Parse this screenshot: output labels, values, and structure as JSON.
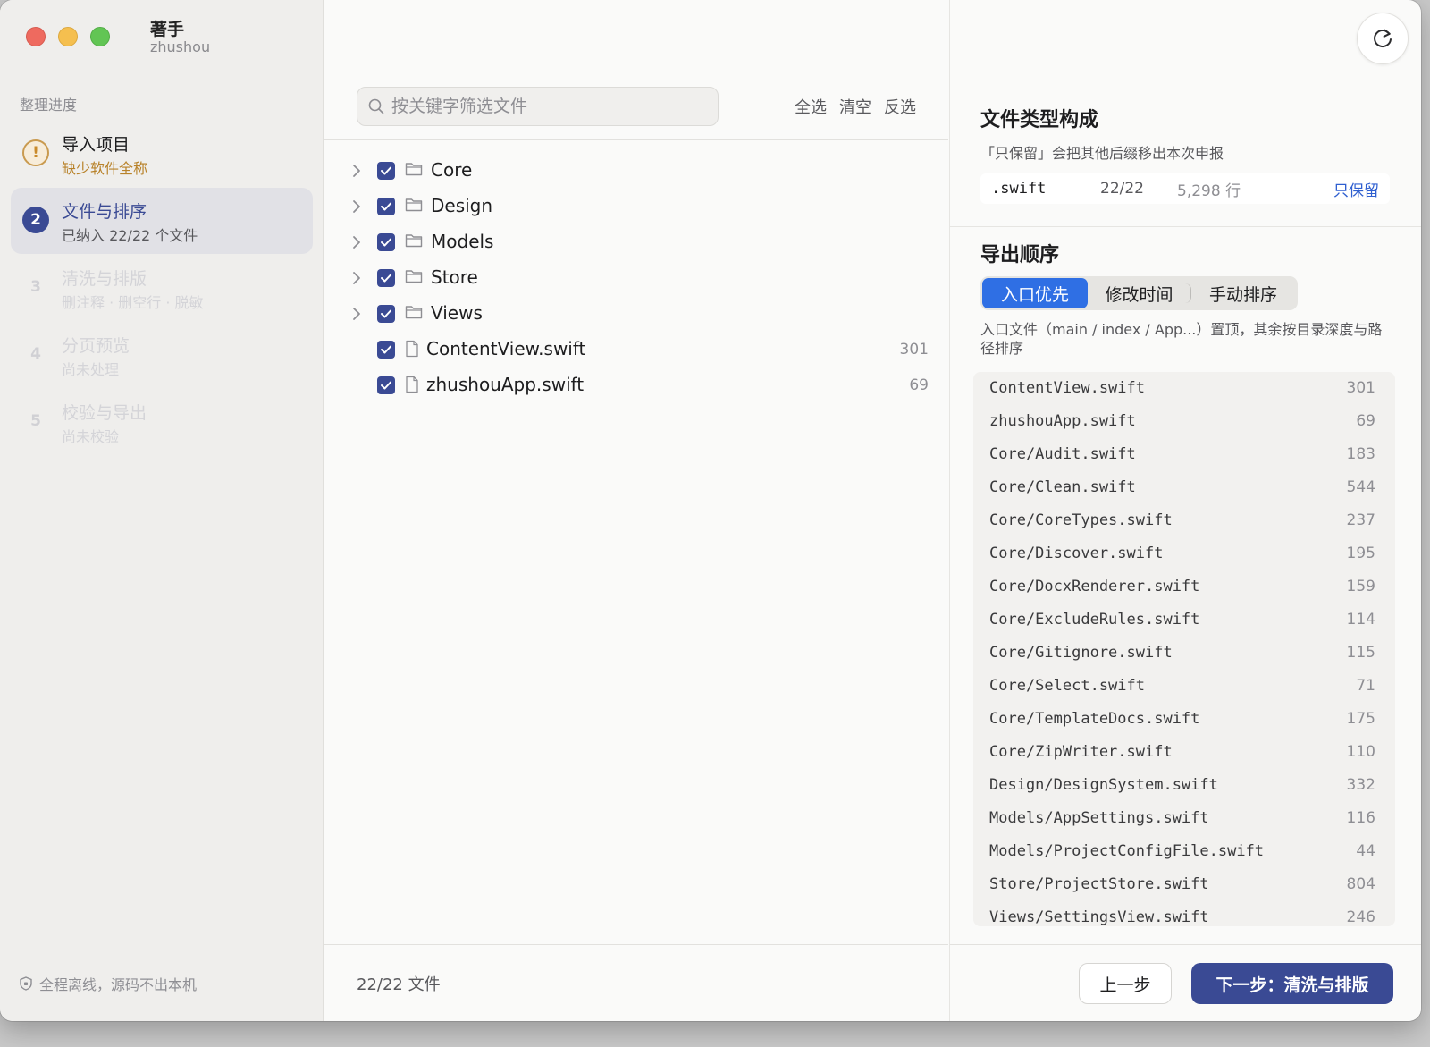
{
  "app": {
    "title": "著手",
    "subtitle": "zhushou"
  },
  "sidebar": {
    "section_label": "整理进度",
    "steps": [
      {
        "num": "!",
        "title": "导入项目",
        "desc": "缺少软件全称",
        "state": "warning"
      },
      {
        "num": "2",
        "title": "文件与排序",
        "desc": "已纳入 22/22 个文件",
        "state": "active"
      },
      {
        "num": "3",
        "title": "清洗与排版",
        "desc": "删注释 · 删空行 · 脱敏",
        "state": "disabled"
      },
      {
        "num": "4",
        "title": "分页预览",
        "desc": "尚未处理",
        "state": "disabled"
      },
      {
        "num": "5",
        "title": "校验与导出",
        "desc": "尚未校验",
        "state": "disabled"
      }
    ],
    "footer_note": "全程离线，源码不出本机"
  },
  "files": {
    "search_placeholder": "按关键字筛选文件",
    "actions": {
      "select_all": "全选",
      "clear": "清空",
      "invert": "反选"
    },
    "tree": [
      {
        "name": "Core",
        "type": "folder",
        "checked": true,
        "count": ""
      },
      {
        "name": "Design",
        "type": "folder",
        "checked": true,
        "count": ""
      },
      {
        "name": "Models",
        "type": "folder",
        "checked": true,
        "count": ""
      },
      {
        "name": "Store",
        "type": "folder",
        "checked": true,
        "count": ""
      },
      {
        "name": "Views",
        "type": "folder",
        "checked": true,
        "count": ""
      },
      {
        "name": "ContentView.swift",
        "type": "file",
        "checked": true,
        "count": "301"
      },
      {
        "name": "zhushouApp.swift",
        "type": "file",
        "checked": true,
        "count": "69"
      }
    ],
    "total": "22/22 文件"
  },
  "composition": {
    "title": "文件类型构成",
    "subtitle": "「只保留」会把其他后缀移出本次申报",
    "types": [
      {
        "ext": ".swift",
        "count": "22/22",
        "lines": "5,298 行",
        "action": "只保留"
      }
    ]
  },
  "export_order": {
    "title": "导出顺序",
    "tabs": [
      "入口优先",
      "修改时间",
      "手动排序"
    ],
    "active_tab": "入口优先",
    "note": "入口文件（main / index / App...）置顶，其余按目录深度与路径排序",
    "list": [
      {
        "path": "ContentView.swift",
        "lines": "301"
      },
      {
        "path": "zhushouApp.swift",
        "lines": "69"
      },
      {
        "path": "Core/Audit.swift",
        "lines": "183"
      },
      {
        "path": "Core/Clean.swift",
        "lines": "544"
      },
      {
        "path": "Core/CoreTypes.swift",
        "lines": "237"
      },
      {
        "path": "Core/Discover.swift",
        "lines": "195"
      },
      {
        "path": "Core/DocxRenderer.swift",
        "lines": "159"
      },
      {
        "path": "Core/ExcludeRules.swift",
        "lines": "114"
      },
      {
        "path": "Core/Gitignore.swift",
        "lines": "115"
      },
      {
        "path": "Core/Select.swift",
        "lines": "71"
      },
      {
        "path": "Core/TemplateDocs.swift",
        "lines": "175"
      },
      {
        "path": "Core/ZipWriter.swift",
        "lines": "110"
      },
      {
        "path": "Design/DesignSystem.swift",
        "lines": "332"
      },
      {
        "path": "Models/AppSettings.swift",
        "lines": "116"
      },
      {
        "path": "Models/ProjectConfigFile.swift",
        "lines": "44"
      },
      {
        "path": "Store/ProjectStore.swift",
        "lines": "804"
      },
      {
        "path": "Views/SettingsView.swift",
        "lines": "246"
      }
    ]
  },
  "buttons": {
    "prev": "上一步",
    "next": "下一步：清洗与排版"
  },
  "colors": {
    "accent": "#3a4a94",
    "tab_active": "#2f6fe4",
    "warning": "#b8822a",
    "link": "#2f5fd0"
  }
}
